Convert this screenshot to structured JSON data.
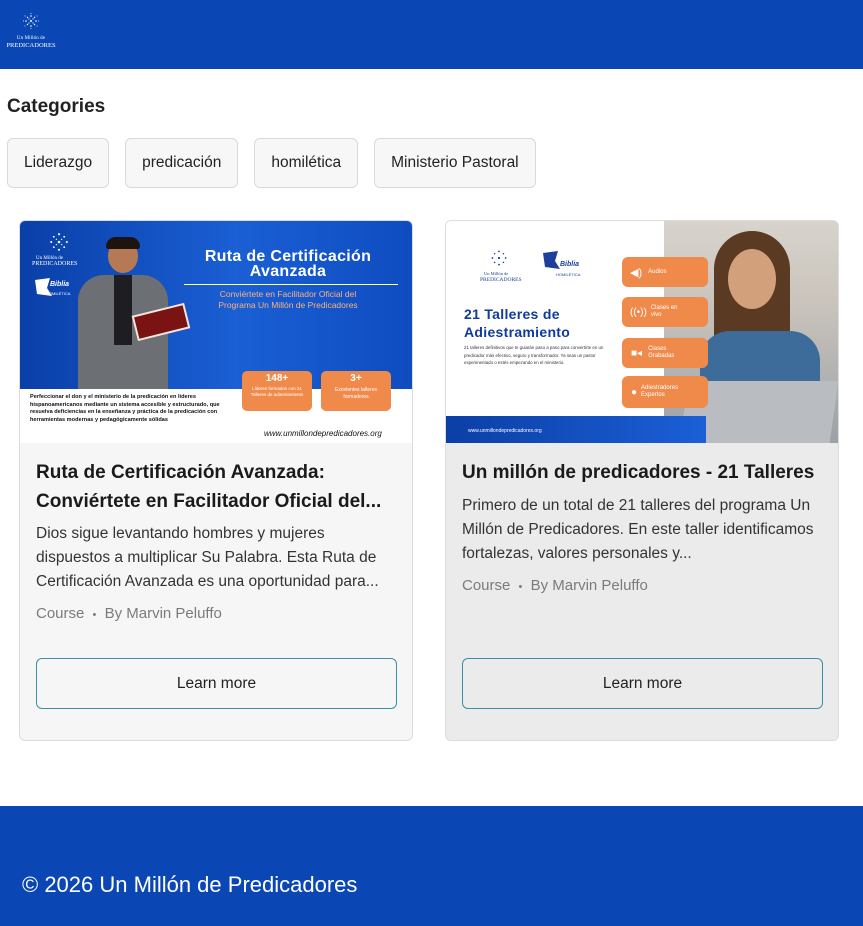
{
  "header": {
    "logo_line1": "Un Millón de",
    "logo_line2": "PREDICADORES"
  },
  "categories": {
    "title": "Categories",
    "items": [
      "Liderazgo",
      "predicación",
      "homilética",
      "Ministerio Pastoral"
    ]
  },
  "cards": [
    {
      "title": "Ruta de Certificación Avanzada: Conviértete en Facilitador Oficial del...",
      "description": "Dios sigue levantando hombres y mujeres dispuestos a multiplicar Su Palabra. Esta Ruta de Certificación Avanzada es una oportunidad para...",
      "meta_type": "Course",
      "meta_sep": "•",
      "meta_author": "By Marvin Peluffo",
      "button": "Learn more",
      "thumb": {
        "brand_top": "Un Millón de",
        "brand_bottom": "PREDICADORES",
        "biblia": "Biblia",
        "homiletica": "HOMILÉTICA",
        "heading1": "Ruta de Certificación",
        "heading2": "Avanzada",
        "sub1": "Conviértete en Facilitador Oficial del",
        "sub2": "Programa Un Millón de Predicadores",
        "stat1_value": "148+",
        "stat1_label": "Líderes formados con 21 Talleres de adiestramiento",
        "stat2_value": "3+",
        "stat2_label": "Excelentes talleres formadores",
        "blurb": "Perfeccionar el don y el ministerio de la predicación en líderes hispanoamericanos mediante un sistema accesible y estructurado, que resuelva deficiencias en la enseñanza y práctica de la predicación con herramientas modernas y pedagógicamente sólidas",
        "url": "www.unmillondepredicadores.org"
      }
    },
    {
      "title": "Un millón de predicadores - 21 Talleres",
      "description": "Primero de un total de 21 talleres del programa Un Millón de Predicadores. En este taller identificamos fortalezas, valores personales y...",
      "meta_type": "Course",
      "meta_sep": "•",
      "meta_author": "By Marvin Peluffo",
      "button": "Learn more",
      "thumb": {
        "brand_top": "Un Millón de",
        "brand_bottom": "PREDICADORES",
        "biblia": "Biblia",
        "homiletica": "HOMILÉTICA",
        "heading1": "21 Talleres de",
        "heading2": "Adiestramiento",
        "body": "21 talleres definitivos que te guiarán paso a paso para convertirte en un predicador más efectivo, seguro y transformador. Ya seas un pastor experimentado o estés empezando en el ministerio.",
        "url": "www.unmillondepredicadores.org",
        "features": [
          "Audios",
          "Clases en vivo",
          "Clases Grabadas",
          "Adiestradores Expertos"
        ]
      }
    }
  ],
  "footer": {
    "copyright": "© 2026 Un Millón de Predicadores"
  },
  "colors": {
    "brand_blue": "#0a46b4",
    "accent_orange": "#f08a4b",
    "button_border": "#3a8fa8"
  }
}
